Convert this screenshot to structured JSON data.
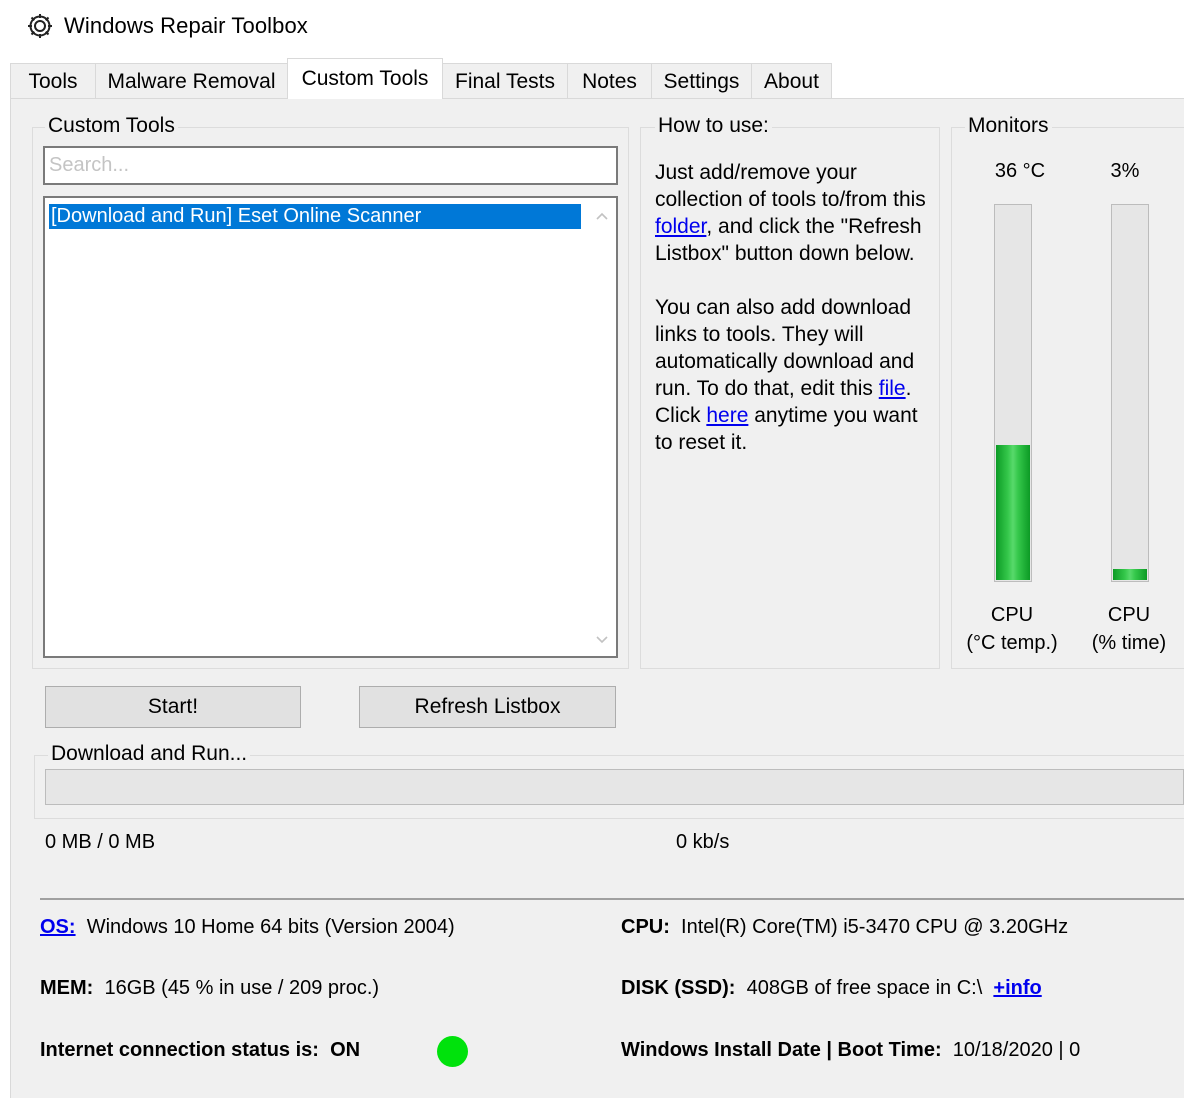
{
  "window": {
    "title": "Windows Repair Toolbox",
    "icon": "gear-wrench-icon"
  },
  "tabs": [
    {
      "label": "Tools"
    },
    {
      "label": "Malware Removal"
    },
    {
      "label": "Custom Tools",
      "active": true
    },
    {
      "label": "Final Tests"
    },
    {
      "label": "Notes"
    },
    {
      "label": "Settings"
    },
    {
      "label": "About"
    }
  ],
  "custom_tools": {
    "group_title": "Custom Tools",
    "search_placeholder": "Search...",
    "search_value": "",
    "items": [
      "[Download and Run] Eset Online Scanner"
    ],
    "selected_index": 0
  },
  "howto": {
    "group_title": "How to use:",
    "p1_a": "Just add/remove your collection of tools to/from this ",
    "p1_link": "folder",
    "p1_b": ", and click the \"Refresh Listbox\" button down below.",
    "p2_a": "You can also add download links to tools. They will automatically download and run. To do that, edit this ",
    "p2_link1": "file",
    "p2_b": ". Click ",
    "p2_link2": "here",
    "p2_c": " anytime you want to reset it."
  },
  "monitors": {
    "group_title": "Monitors",
    "cpu_temp": {
      "value": "36 °C",
      "level": 0.36,
      "label1": "CPU",
      "label2": "(°C temp.)"
    },
    "cpu_time": {
      "value": "3%",
      "level": 0.03,
      "label1": "CPU",
      "label2": "(% time)"
    }
  },
  "buttons": {
    "start": "Start!",
    "refresh": "Refresh Listbox"
  },
  "download": {
    "group_title": "Download and Run...",
    "progress": 0,
    "size_text": "0 MB / 0 MB",
    "speed_text": "0 kb/s"
  },
  "sysinfo": {
    "os_label": "OS:",
    "os_value": "Windows 10 Home 64 bits (Version 2004)",
    "cpu_label": "CPU:",
    "cpu_value": "Intel(R) Core(TM) i5-3470 CPU @ 3.20GHz",
    "mem_label": "MEM:",
    "mem_value": "16GB  (45 % in use / 209 proc.)",
    "disk_label": "DISK (SSD):",
    "disk_value": "408GB of free space in C:\\",
    "disk_link": "+info",
    "internet_label": "Internet connection status is:",
    "internet_value": "ON",
    "internet_color": "#00e20c",
    "install_label": "Windows Install Date | Boot Time:",
    "install_value": "10/18/2020  |  0"
  }
}
